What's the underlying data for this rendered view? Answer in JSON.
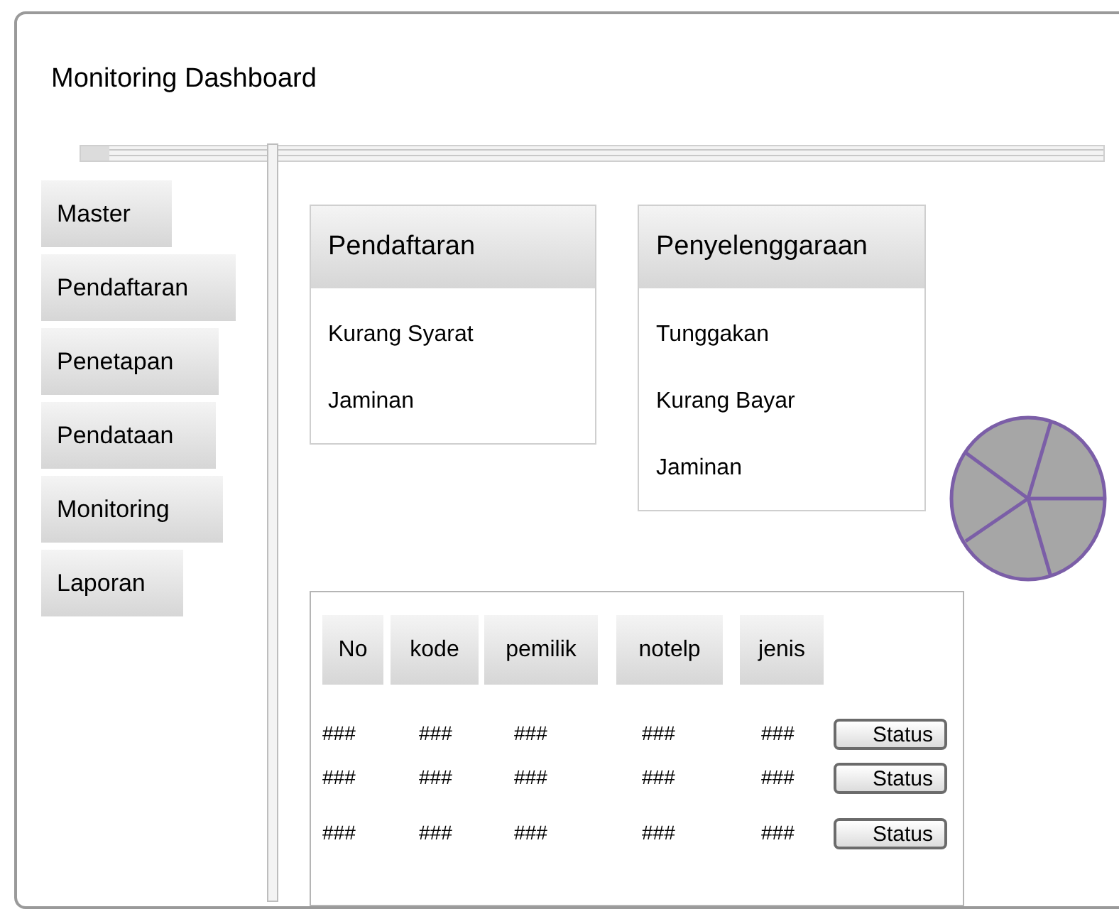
{
  "window": {
    "title": "Monitoring Dashboard"
  },
  "sidebar": {
    "items": [
      "Master",
      "Pendaftaran",
      "Penetapan",
      "Pendataan",
      "Monitoring",
      "Laporan"
    ]
  },
  "panels": [
    {
      "title": "Pendaftaran",
      "items": [
        "Kurang Syarat",
        "Jaminan"
      ]
    },
    {
      "title": "Penyelenggaraan",
      "items": [
        "Tunggakan",
        "Kurang Bayar",
        "Jaminan"
      ]
    }
  ],
  "table": {
    "columns": [
      "No",
      "kode",
      "pemilik",
      "notelp",
      "jenis"
    ],
    "rows": [
      {
        "cells": [
          "###",
          "###",
          "###",
          "###",
          "###"
        ],
        "action": "Status"
      },
      {
        "cells": [
          "###",
          "###",
          "###",
          "###",
          "###"
        ],
        "action": "Status"
      },
      {
        "cells": [
          "###",
          "###",
          "###",
          "###",
          "###"
        ],
        "action": "Status"
      }
    ]
  }
}
